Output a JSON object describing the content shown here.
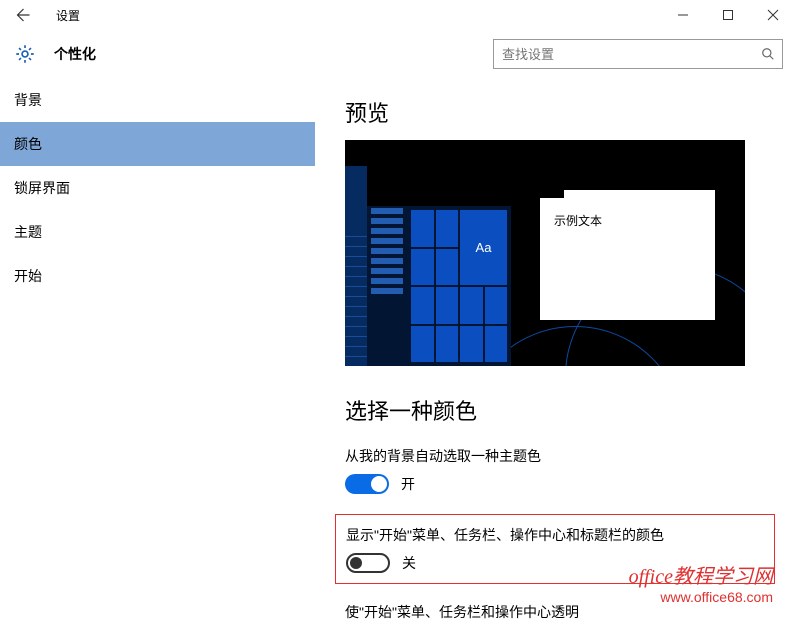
{
  "window": {
    "title": "设置"
  },
  "header": {
    "page_title": "个性化"
  },
  "search": {
    "placeholder": "查找设置"
  },
  "sidebar": {
    "items": [
      {
        "label": "背景"
      },
      {
        "label": "颜色"
      },
      {
        "label": "锁屏界面"
      },
      {
        "label": "主题"
      },
      {
        "label": "开始"
      }
    ],
    "selected_index": 1
  },
  "content": {
    "preview_heading": "预览",
    "sample_tile_text": "Aa",
    "sample_window_text": "示例文本",
    "pick_color_heading": "选择一种颜色",
    "auto_pick_label": "从我的背景自动选取一种主题色",
    "auto_pick_state": "开",
    "accent_label": "显示\"开始\"菜单、任务栏、操作中心和标题栏的颜色",
    "accent_state": "关",
    "transparent_label": "使\"开始\"菜单、任务栏和操作中心透明"
  },
  "watermark": {
    "line1": "office教程学习网",
    "line2": "www.office68.com"
  }
}
